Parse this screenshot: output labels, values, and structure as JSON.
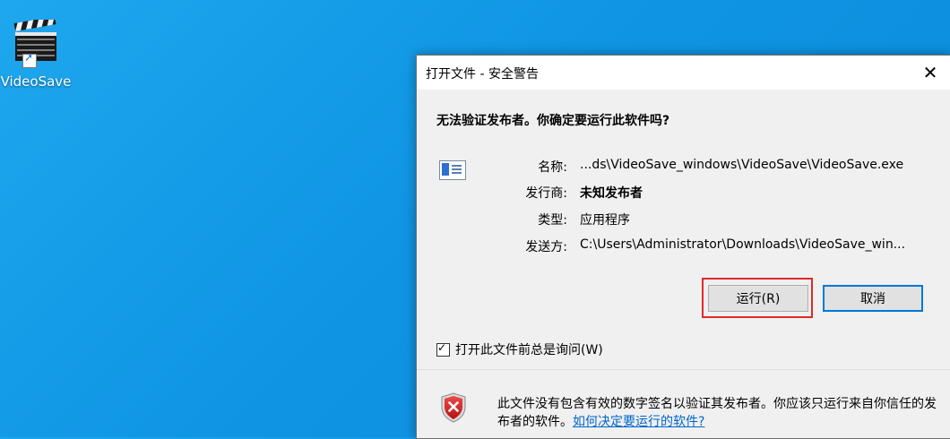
{
  "desktop": {
    "icon_label": "VideoSave"
  },
  "dialog": {
    "title": "打开文件 - 安全警告",
    "close_glyph": "✕",
    "question": "无法验证发布者。你确定要运行此软件吗?",
    "fields": [
      {
        "key": "名称:",
        "value": "...ds\\VideoSave_windows\\VideoSave\\VideoSave.exe",
        "bold": false
      },
      {
        "key": "发行商:",
        "value": "未知发布者",
        "bold": true
      },
      {
        "key": "类型:",
        "value": "应用程序",
        "bold": false
      },
      {
        "key": "发送方:",
        "value": "C:\\Users\\Administrator\\Downloads\\VideoSave_win...",
        "bold": false
      }
    ],
    "run_button": "运行(R)",
    "cancel_button": "取消",
    "checkbox_label": "打开此文件前总是询问(W)",
    "checkbox_checked": true,
    "warning_text": "此文件没有包含有效的数字签名以验证其发布者。你应该只运行来自你信任的发布者的软件。",
    "warning_link": "如何决定要运行的软件?"
  },
  "colors": {
    "desktop_bg": "#1296e8",
    "highlight": "#e02a2a",
    "link": "#0066cc",
    "accent": "#0078d7"
  }
}
